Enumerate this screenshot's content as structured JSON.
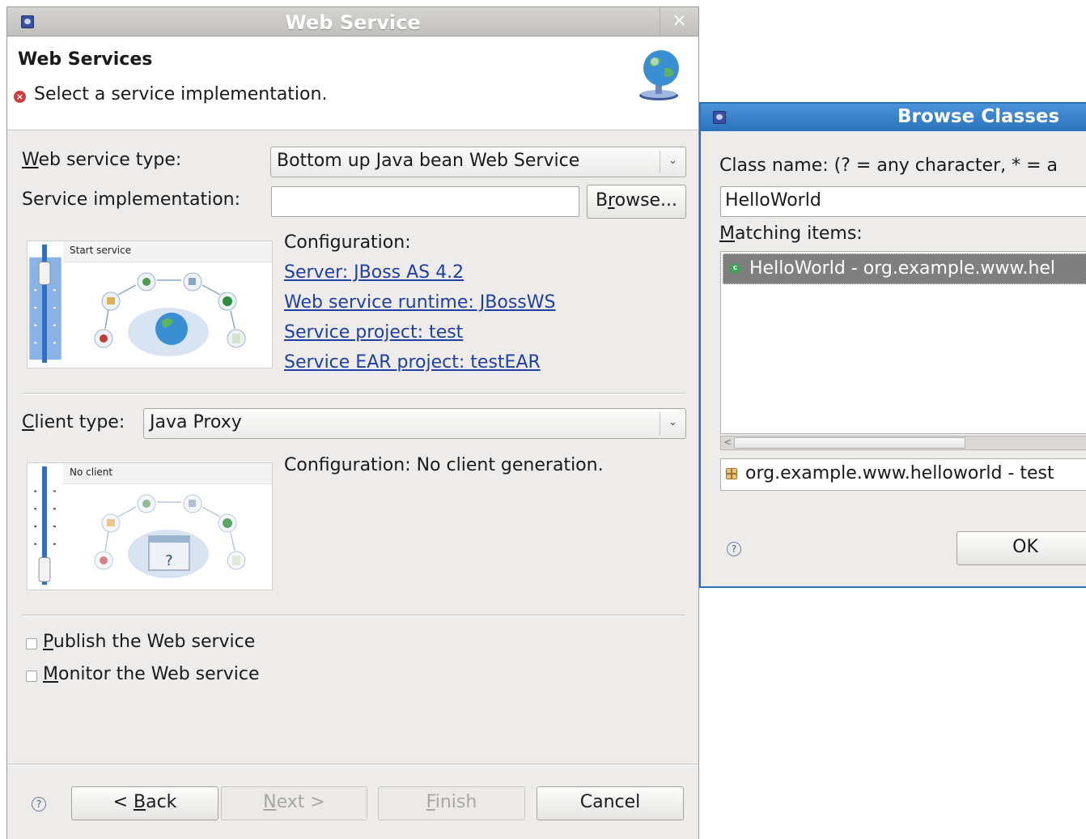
{
  "main_dialog": {
    "title": "Web Service",
    "close_glyph": "×",
    "banner": {
      "title": "Web Services",
      "error_message": "Select a service implementation.",
      "error_glyph": "×"
    },
    "service_type": {
      "label_mnemonic": "W",
      "label_rest": "eb service type:",
      "value": "Bottom up Java bean Web Service",
      "arrow": "⌄"
    },
    "service_implementation": {
      "label": "Service implementation:",
      "value": "",
      "browse_pre": "B",
      "browse_mnemonic": "r",
      "browse_post": "owse..."
    },
    "service_illustration": {
      "caption": "Start service"
    },
    "service_config": {
      "heading": "Configuration:",
      "links": [
        "Server: JBoss AS 4.2",
        "Web service runtime: JBossWS",
        "Service project: test",
        "Service EAR project: testEAR"
      ]
    },
    "client_type": {
      "label_mnemonic": "C",
      "label_rest": "lient type:",
      "value": "Java Proxy",
      "arrow": "⌄"
    },
    "client_illustration": {
      "caption": "No client"
    },
    "client_config": {
      "text": "Configuration: No client generation."
    },
    "checkboxes": [
      {
        "mnemonic": "P",
        "rest": "ublish the Web service",
        "checked": false
      },
      {
        "mnemonic": "M",
        "rest": "onitor the Web service",
        "checked": false
      }
    ],
    "buttons": {
      "back": {
        "pre": "< ",
        "mnemonic": "B",
        "post": "ack"
      },
      "next": {
        "mnemonic": "N",
        "post": "ext >"
      },
      "finish": {
        "mnemonic": "F",
        "post": "inish"
      },
      "cancel": "Cancel"
    },
    "help_glyph": "?"
  },
  "browse_dialog": {
    "title": "Browse Classes",
    "class_name_label": "Class name: (? = any character, * = a",
    "class_name_value": "HelloWorld",
    "matching_mnemonic": "M",
    "matching_rest": "atching items:",
    "items": [
      {
        "icon": "class-icon",
        "icon_glyph": "c",
        "text": "HelloWorld - org.example.www.hel",
        "selected": true
      }
    ],
    "scroll_arrow": "<",
    "package_text": "org.example.www.helloworld - test",
    "ok_label": "OK",
    "help_glyph": "?"
  },
  "colors": {
    "link": "#1f3fa3",
    "browse_titlebar": "#2a72bb",
    "selection": "#7f7f7f",
    "error": "#d03c3c"
  }
}
